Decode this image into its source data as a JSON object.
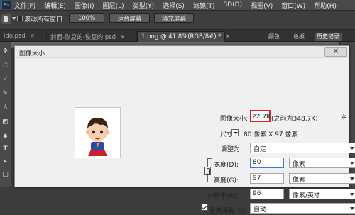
{
  "app": {
    "logo": "Ps"
  },
  "menu": [
    "文件(F)",
    "编辑(E)",
    "图像(I)",
    "图层(L)",
    "类型(Y)",
    "选择(S)",
    "滤镜(T)",
    "3D(D)",
    "视图(V)",
    "窗口(W)",
    "帮助(H)"
  ],
  "options_bar": {
    "scroll_all_windows_label": "滚动所有窗口",
    "scroll_all_windows_checked": false,
    "zoom_100_label": "100%",
    "fit_screen_label": "适合屏幕",
    "fill_screen_label": "填充屏幕"
  },
  "doc_tabs": [
    {
      "label": "ldo.psd",
      "close": "×",
      "active": false
    },
    {
      "label": "封面-恢复的-恢复的.psd",
      "close": "×",
      "active": false
    },
    {
      "label": "1.png @ 41.8%(RGB/8#) *",
      "close": "×",
      "active": true
    }
  ],
  "panel_tabs": [
    {
      "label": "颜色",
      "active": false
    },
    {
      "label": "色板",
      "active": false
    },
    {
      "label": "历史记录",
      "active": true
    }
  ],
  "dialog": {
    "title": "图像大小",
    "close_glyph": "✕",
    "gear_glyph": "✲",
    "image_size_label": "图像大小:",
    "image_size_value": "22.7K",
    "image_size_previous": "(之前为348.7K)",
    "dimensions_label": "尺寸:",
    "dimensions_value": "80 像素  X  97 像素",
    "fit_to_label": "调整为:",
    "fit_to_value": "自定",
    "width_label": "宽度(D):",
    "width_value": "80",
    "width_unit": "像素",
    "height_label": "高度(G):",
    "height_value": "97",
    "height_unit": "像素",
    "resolution_label": "分辨率(R):",
    "resolution_value": "96",
    "resolution_unit": "像素/英寸",
    "resample_label": "重新采样(S):",
    "resample_checked": true,
    "resample_value": "自动"
  },
  "colors": {
    "highlight_box": "#d8202a",
    "focus_border": "#2c7fe0",
    "dialog_bg": "#f0f0f0",
    "ps_blue": "#3fa4f0"
  }
}
